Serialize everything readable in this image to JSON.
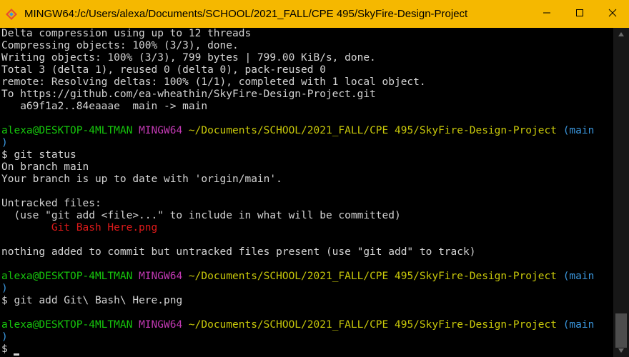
{
  "window": {
    "title": "MINGW64:/c/Users/alexa/Documents/SCHOOL/2021_FALL/CPE 495/SkyFire-Design-Project",
    "brand_color": "#f5b800"
  },
  "prompt": {
    "user_host": "alexa@DESKTOP-4MLTMAN",
    "shell": "MINGW64",
    "path": "~/Documents/SCHOOL/2021_FALL/CPE 495/SkyFire-Design-Project",
    "branch_open": "(main",
    "branch_close": ")",
    "symbol": "$ "
  },
  "output": {
    "push": [
      "Delta compression using up to 12 threads",
      "Compressing objects: 100% (3/3), done.",
      "Writing objects: 100% (3/3), 799 bytes | 799.00 KiB/s, done.",
      "Total 3 (delta 1), reused 0 (delta 0), pack-reused 0",
      "remote: Resolving deltas: 100% (1/1), completed with 1 local object.",
      "To https://github.com/ea-wheathin/SkyFire-Design-Project.git",
      "   a69f1a2..84eaaae  main -> main"
    ],
    "cmd_status": "git status",
    "status": [
      "On branch main",
      "Your branch is up to date with 'origin/main'.",
      "Untracked files:",
      "  (use \"git add <file>...\" to include in what will be committed)",
      "        Git Bash Here.png",
      "nothing added to commit but untracked files present (use \"git add\" to track)"
    ],
    "cmd_add": "git add Git\\ Bash\\ Here.png"
  },
  "colors": {
    "green": "#16c60c",
    "magenta": "#c239b3",
    "yellow": "#c8c80a",
    "cyan": "#3a96dd",
    "red": "#e01a1a",
    "foreground": "#d4d4d4"
  },
  "icons": {
    "app": "git-bash-diamond-icon",
    "minimize": "minimize-icon",
    "maximize": "maximize-icon",
    "close": "close-icon"
  }
}
